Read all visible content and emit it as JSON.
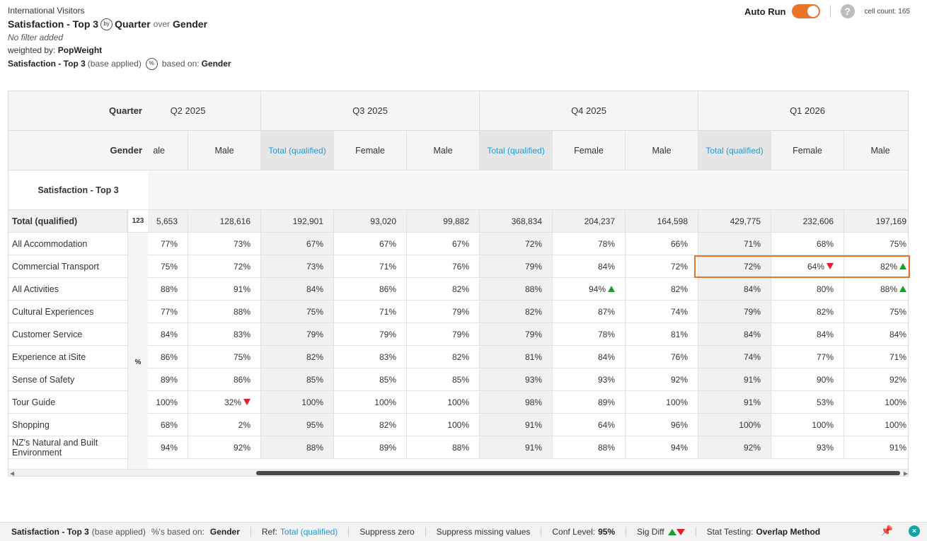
{
  "header": {
    "subtitle": "International Visitors",
    "title_part1": "Satisfaction - Top 3",
    "by_badge": "by",
    "title_part2": "Quarter",
    "over": "over",
    "title_part3": "Gender",
    "no_filter": "No filter added",
    "weighted_label": "weighted by:",
    "weighted_value": "PopWeight",
    "base_title": "Satisfaction - Top 3",
    "base_applied": "(base applied)",
    "pct_badge": "%",
    "based_on_label": "based on:",
    "based_on_value": "Gender"
  },
  "topbar": {
    "auto_run_label": "Auto Run",
    "auto_run_on": true,
    "help": "?",
    "cell_count": "cell count: 165"
  },
  "table": {
    "quarter_label": "Quarter",
    "gender_label": "Gender",
    "section_label": "Satisfaction - Top 3",
    "unit_123": "123",
    "unit_pct": "%",
    "quarters": [
      "Q2 2025",
      "Q3 2025",
      "Q4 2025",
      "Q1 2026"
    ],
    "genders": [
      "Female",
      "Male",
      "Total (qualified)",
      "Female",
      "Male",
      "Total (qualified)",
      "Female",
      "Male",
      "Total (qualified)",
      "Female",
      "Male"
    ],
    "partial_gender": "ale",
    "rows": [
      {
        "label": "Total (qualified)",
        "values": [
          "5,653",
          "128,616",
          "192,901",
          "93,020",
          "99,882",
          "368,834",
          "204,237",
          "164,598",
          "429,775",
          "232,606",
          "197,169"
        ]
      },
      {
        "label": "All Accommodation",
        "values": [
          "77%",
          "73%",
          "67%",
          "67%",
          "67%",
          "72%",
          "78%",
          "66%",
          "71%",
          "68%",
          "75%"
        ]
      },
      {
        "label": "Commercial Transport",
        "values": [
          "75%",
          "72%",
          "73%",
          "71%",
          "76%",
          "79%",
          "84%",
          "72%",
          "72%",
          "64%",
          "82%"
        ]
      },
      {
        "label": "All Activities",
        "values": [
          "88%",
          "91%",
          "84%",
          "86%",
          "82%",
          "88%",
          "94%",
          "82%",
          "84%",
          "80%",
          "88%"
        ]
      },
      {
        "label": "Cultural Experiences",
        "values": [
          "77%",
          "88%",
          "75%",
          "71%",
          "79%",
          "82%",
          "87%",
          "74%",
          "79%",
          "82%",
          "75%"
        ]
      },
      {
        "label": "Customer Service",
        "values": [
          "84%",
          "83%",
          "79%",
          "79%",
          "79%",
          "79%",
          "78%",
          "81%",
          "84%",
          "84%",
          "84%"
        ]
      },
      {
        "label": "Experience at iSite",
        "values": [
          "86%",
          "75%",
          "82%",
          "83%",
          "82%",
          "81%",
          "84%",
          "76%",
          "74%",
          "77%",
          "71%"
        ]
      },
      {
        "label": "Sense of Safety",
        "values": [
          "89%",
          "86%",
          "85%",
          "85%",
          "85%",
          "93%",
          "93%",
          "92%",
          "91%",
          "90%",
          "92%"
        ]
      },
      {
        "label": "Tour Guide",
        "values": [
          "100%",
          "32%",
          "100%",
          "100%",
          "100%",
          "98%",
          "89%",
          "100%",
          "91%",
          "53%",
          "100%"
        ]
      },
      {
        "label": "Shopping",
        "values": [
          "68%",
          "2%",
          "95%",
          "82%",
          "100%",
          "91%",
          "64%",
          "96%",
          "100%",
          "100%",
          "100%"
        ]
      },
      {
        "label": "NZ's Natural and Built Environment",
        "values": [
          "94%",
          "92%",
          "88%",
          "89%",
          "88%",
          "91%",
          "88%",
          "94%",
          "92%",
          "93%",
          "91%"
        ]
      }
    ],
    "sig": [
      {
        "row": 2,
        "col": 9,
        "dir": "down"
      },
      {
        "row": 2,
        "col": 10,
        "dir": "up"
      },
      {
        "row": 3,
        "col": 6,
        "dir": "up"
      },
      {
        "row": 3,
        "col": 10,
        "dir": "up"
      },
      {
        "row": 8,
        "col": 1,
        "dir": "down"
      }
    ]
  },
  "footer": {
    "title": "Satisfaction - Top 3",
    "base_applied": "(base applied)",
    "pct_based_on": "%'s based on:",
    "gender": "Gender",
    "ref_label": "Ref:",
    "ref_value": "Total (qualified)",
    "suppress_zero": "Suppress zero",
    "suppress_missing": "Suppress missing values",
    "conf_label": "Conf Level:",
    "conf_value": "95%",
    "sig_label": "Sig Diff",
    "stat_label": "Stat Testing:",
    "stat_value": "Overlap Method",
    "close": "×"
  },
  "colors": {
    "accent_orange": "#e8742a",
    "link_blue": "#1a9be0",
    "sig_up": "#1e9b2f",
    "sig_down": "#e0202a"
  }
}
